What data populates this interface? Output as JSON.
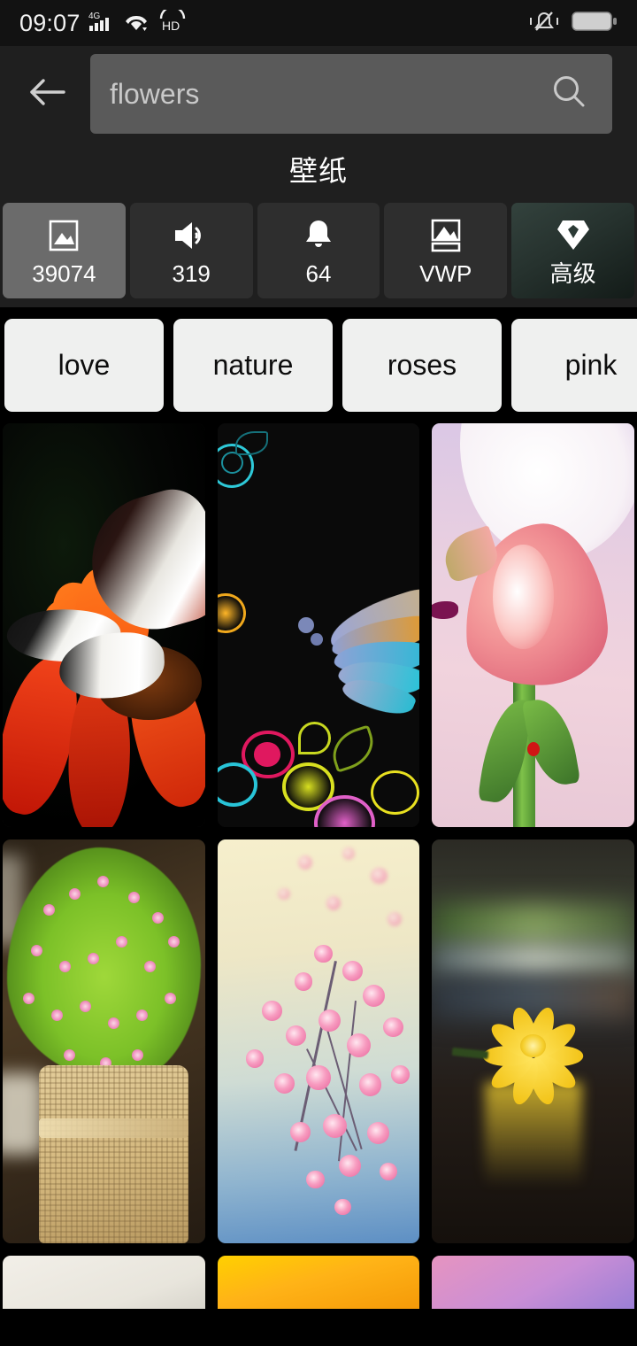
{
  "statusbar": {
    "time": "09:07",
    "network_label": "4G",
    "volte_label": "HD",
    "icons": [
      "signal-icon",
      "wifi-icon",
      "hd-icon",
      "vibrate-mute-icon",
      "battery-icon"
    ]
  },
  "header": {
    "back_icon": "back-arrow-icon",
    "search": {
      "value": "flowers",
      "placeholder": "flowers",
      "search_icon": "search-icon"
    },
    "title": "壁纸"
  },
  "category_tabs": [
    {
      "id": "wallpapers",
      "label": "39074",
      "icon": "image-icon",
      "selected": true,
      "style": "normal"
    },
    {
      "id": "ringtones",
      "label": "319",
      "icon": "speaker-icon",
      "selected": false,
      "style": "normal"
    },
    {
      "id": "notifications",
      "label": "64",
      "icon": "bell-icon",
      "selected": false,
      "style": "normal"
    },
    {
      "id": "vwp",
      "label": "VWP",
      "icon": "live-wallpaper-icon",
      "selected": false,
      "style": "normal"
    },
    {
      "id": "premium",
      "label": "高级",
      "icon": "diamond-icon",
      "selected": false,
      "style": "premium"
    }
  ],
  "suggestion_chips": [
    {
      "label": "love"
    },
    {
      "label": "nature"
    },
    {
      "label": "roses"
    },
    {
      "label": "pink"
    }
  ],
  "wallpaper_grid": {
    "rows": [
      [
        {
          "id": "wp-1",
          "description": "butterfly on orange flower",
          "art": "a1"
        },
        {
          "id": "wp-2",
          "description": "neon floral line art on black",
          "art": "a2"
        },
        {
          "id": "wp-3",
          "description": "pink calla lily with moon",
          "art": "a3"
        }
      ],
      [
        {
          "id": "wp-4",
          "description": "pink flowers in burlap pot",
          "art": "a4"
        },
        {
          "id": "wp-5",
          "description": "pink blossom branch",
          "art": "a5"
        },
        {
          "id": "wp-6",
          "description": "yellow flower on wood",
          "art": "a6"
        }
      ],
      [
        {
          "id": "wp-7",
          "description": "white minimal wallpaper",
          "art": "p1"
        },
        {
          "id": "wp-8",
          "description": "orange gradient wallpaper",
          "art": "p2"
        },
        {
          "id": "wp-9",
          "description": "pink purple gradient wallpaper",
          "art": "p3"
        }
      ]
    ]
  },
  "colors": {
    "background": "#000000",
    "chrome": "#1f1f1f",
    "statusbar": "#121212",
    "tab": "#2e2e2e",
    "tab_selected": "#6b6b6b",
    "premium_tab": "#33423d",
    "chip": "#eff0ef",
    "search_field": "#5a5a5a",
    "text_primary": "#ffffff",
    "text_muted": "#c9c9c9"
  }
}
